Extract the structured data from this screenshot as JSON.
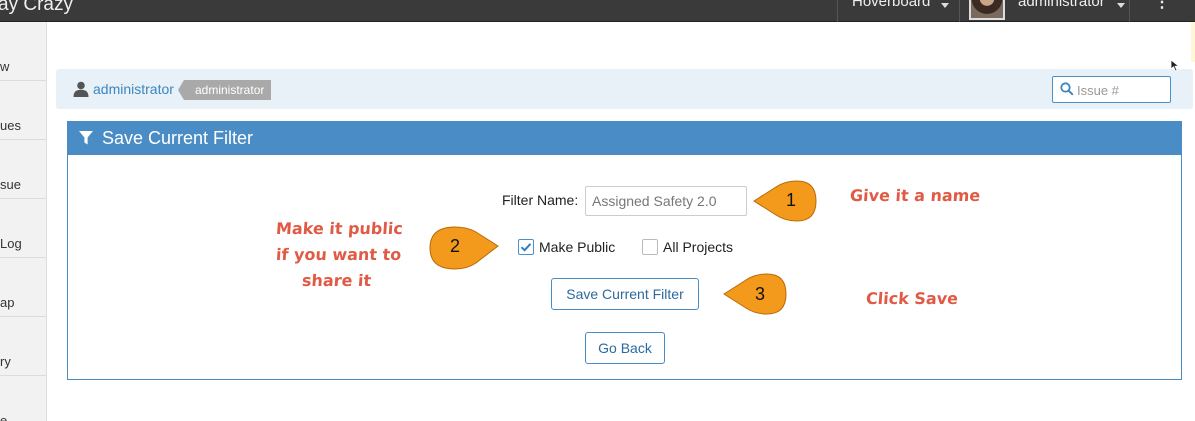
{
  "navbar": {
    "brand": "ay Crazy",
    "hoverboard": "Hoverboard",
    "user": "administrator",
    "more": "⋮"
  },
  "sidebar": {
    "items": [
      {
        "label": "w"
      },
      {
        "label": "ues"
      },
      {
        "label": "sue"
      },
      {
        "label": "Log"
      },
      {
        "label": "ap"
      },
      {
        "label": "ry"
      },
      {
        "label": "e"
      }
    ]
  },
  "breadcrumb": {
    "user_link": "administrator",
    "role_tag": "administrator"
  },
  "search": {
    "placeholder": "Issue #",
    "value": ""
  },
  "panel": {
    "title": "Save Current Filter",
    "filter_name_label": "Filter Name:",
    "filter_name_value": "Assigned Safety 2.0",
    "make_public_label": "Make Public",
    "make_public_checked": true,
    "all_projects_label": "All Projects",
    "all_projects_checked": false,
    "save_button": "Save Current Filter",
    "back_button": "Go Back"
  },
  "annotations": {
    "step1": "1",
    "step2": "2",
    "step3": "3",
    "note1": "Give it a name",
    "note2_line1": "Make it public",
    "note2_line2": "if you want to",
    "note2_line3": "share it",
    "note3": "Click Save"
  },
  "colors": {
    "panel_blue": "#4a8cc6",
    "callout_orange": "#f39a1c",
    "note_red": "#e05a45",
    "navbar": "#3a3a3a"
  }
}
